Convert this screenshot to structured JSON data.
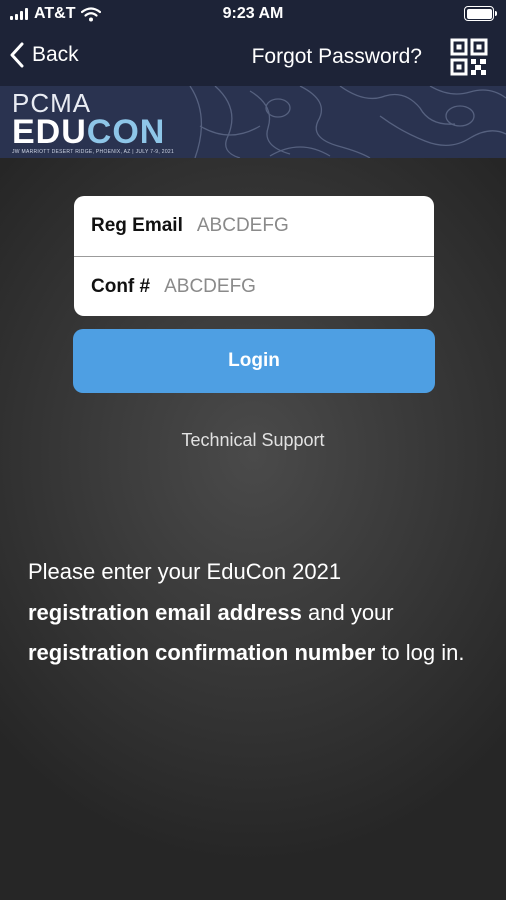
{
  "status_bar": {
    "carrier": "AT&T",
    "time": "9:23 AM"
  },
  "nav": {
    "back_label": "Back",
    "forgot_label": "Forgot Password?",
    "qr_icon": "qr-code-icon"
  },
  "banner": {
    "brand_top": "PCMA",
    "brand_main_1": "EDU",
    "brand_main_2": "CON",
    "brand_sub": "JW MARRIOTT DESERT RIDGE, PHOENIX, AZ | JULY 7-9, 2021"
  },
  "form": {
    "email_label": "Reg Email",
    "email_value": "ABCDEFG",
    "conf_label": "Conf #",
    "conf_value": "ABCDEFG",
    "login_label": "Login"
  },
  "support": {
    "label": "Technical Support"
  },
  "instructions": {
    "part1": "Please enter your EduCon 2021 ",
    "bold1": "registration email address",
    "part2": " and your ",
    "bold2": "registration confirmation number",
    "part3": " to log in."
  },
  "colors": {
    "nav_bg": "#1d2337",
    "login_button": "#4e9fe3",
    "page_bg": "#3a3a3a"
  }
}
